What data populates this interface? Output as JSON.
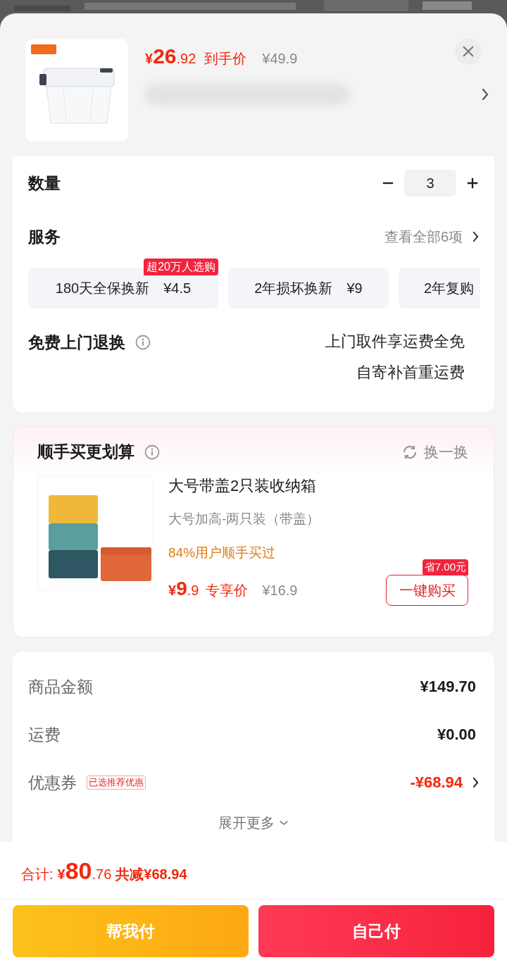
{
  "product": {
    "currency": "¥",
    "price_integer": "26",
    "price_decimal": ".92",
    "price_label": "到手价",
    "original_price": "¥49.9"
  },
  "quantity": {
    "label": "数量",
    "value": "3"
  },
  "services": {
    "label": "服务",
    "view_all": "查看全部6项",
    "options": [
      {
        "name": "180天全保换新",
        "price": "¥4.5",
        "badge": "超20万人选购"
      },
      {
        "name": "2年损坏换新",
        "price": "¥9"
      },
      {
        "name": "2年复购"
      }
    ]
  },
  "free_return": {
    "label": "免费上门退换",
    "lines": [
      "上门取件享运费全免",
      "自寄补首重运费"
    ]
  },
  "addon": {
    "title": "顺手买更划算",
    "refresh": "换一换",
    "item": {
      "name": "大号带盖2只装收纳箱",
      "variant": "大号加高-两只装（带盖）",
      "social_proof": "84%用户顺手买过",
      "currency": "¥",
      "price_integer": "9",
      "price_decimal": ".9",
      "price_label": "专享价",
      "original_price": "¥16.9",
      "save_badge": "省7.00元",
      "buy_button": "一键购买"
    }
  },
  "summary": {
    "rows": [
      {
        "label": "商品金额",
        "value": "¥149.70",
        "kind": "plain"
      },
      {
        "label": "运费",
        "value": "¥0.00",
        "kind": "plain"
      },
      {
        "label": "优惠券",
        "tag": "已选推荐优惠",
        "value": "-¥68.94",
        "kind": "discount"
      }
    ],
    "expand": "展开更多"
  },
  "footer": {
    "total_label": "合计:",
    "currency": "¥",
    "total_integer": "80",
    "total_decimal": ".76",
    "saved": "共减¥68.94",
    "buttons": [
      {
        "label": "帮我付",
        "kind": "secondary"
      },
      {
        "label": "自己付",
        "kind": "primary"
      }
    ]
  }
}
